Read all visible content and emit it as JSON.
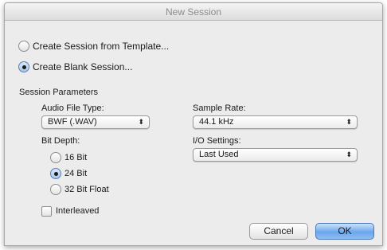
{
  "window": {
    "title": "New Session"
  },
  "options": {
    "from_template": "Create Session from Template...",
    "blank_session": "Create Blank Session..."
  },
  "params": {
    "heading": "Session Parameters",
    "audio_file_type_label": "Audio File Type:",
    "audio_file_type_value": "BWF (.WAV)",
    "sample_rate_label": "Sample Rate:",
    "sample_rate_value": "44.1 kHz",
    "bit_depth_label": "Bit Depth:",
    "bit_depths": [
      "16 Bit",
      "24 Bit",
      "32 Bit Float"
    ],
    "selected_bit_depth": "24 Bit",
    "io_settings_label": "I/O Settings:",
    "io_settings_value": "Last Used",
    "interleaved_label": "Interleaved",
    "interleaved_checked": false
  },
  "buttons": {
    "cancel": "Cancel",
    "ok": "OK"
  }
}
